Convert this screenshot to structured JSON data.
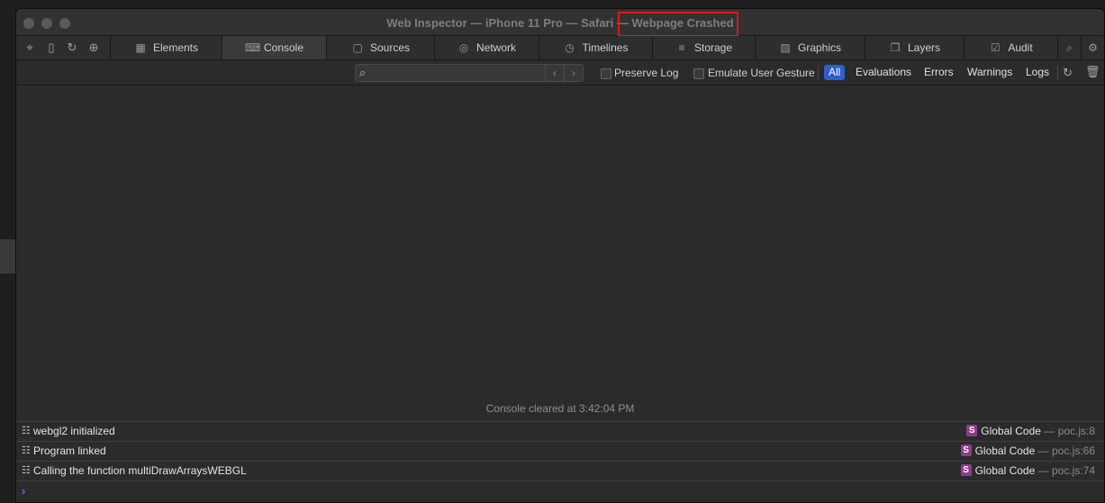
{
  "window": {
    "title": "Web Inspector — iPhone 11 Pro — Safari — Webpage Crashed",
    "highlight_color": "#e0161c"
  },
  "toolbar_icons": [
    "crosshair-icon",
    "device-icon",
    "reload-icon",
    "download-icon"
  ],
  "tabs": [
    {
      "label": "Elements",
      "icon": "elements-icon"
    },
    {
      "label": "Console",
      "icon": "console-icon",
      "active": true
    },
    {
      "label": "Sources",
      "icon": "sources-icon"
    },
    {
      "label": "Network",
      "icon": "network-icon"
    },
    {
      "label": "Timelines",
      "icon": "timelines-icon"
    },
    {
      "label": "Storage",
      "icon": "storage-icon"
    },
    {
      "label": "Graphics",
      "icon": "graphics-icon"
    },
    {
      "label": "Layers",
      "icon": "layers-icon"
    },
    {
      "label": "Audit",
      "icon": "audit-icon"
    }
  ],
  "filter": {
    "search_value": "",
    "preserve_log_label": "Preserve Log",
    "preserve_log_checked": false,
    "emulate_gesture_label": "Emulate User Gesture",
    "emulate_gesture_checked": false,
    "levels": [
      "All",
      "Evaluations",
      "Errors",
      "Warnings",
      "Logs"
    ],
    "selected_level": "All",
    "accent_color": "#2f5fce"
  },
  "console": {
    "cleared_text": "Console cleared at 3:42:04 PM",
    "logs": [
      {
        "message": "webgl2 initialized",
        "badge": "S",
        "source": "Global Code",
        "sep": "—",
        "location": "poc.js:8"
      },
      {
        "message": "Program linked",
        "badge": "S",
        "source": "Global Code",
        "sep": "—",
        "location": "poc.js:66"
      },
      {
        "message": "Calling the function multiDrawArraysWEBGL",
        "badge": "S",
        "source": "Global Code",
        "sep": "—",
        "location": "poc.js:74"
      }
    ],
    "prompt_glyph": "›"
  },
  "side_nav": {
    "left_glyph": "〈",
    "right_glyph": "〉"
  }
}
